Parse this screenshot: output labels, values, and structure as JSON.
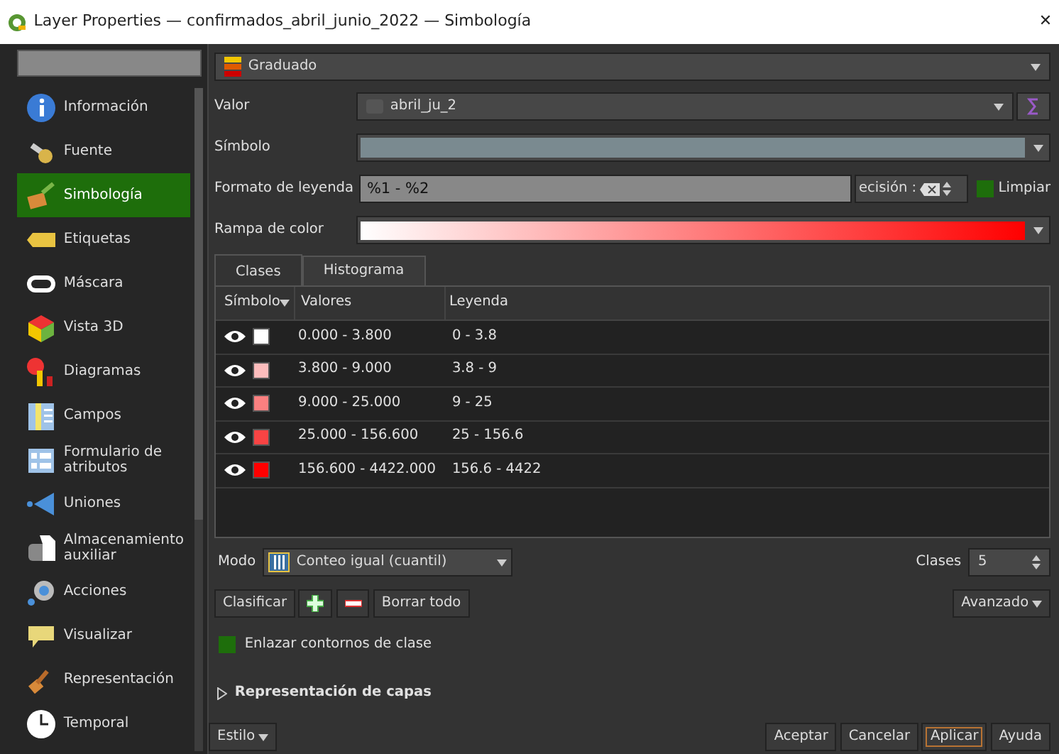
{
  "window": {
    "title": "Layer Properties — confirmados_abril_junio_2022 — Simbología",
    "close": "✕"
  },
  "sidebar": {
    "items": [
      {
        "label": "Información",
        "selected": false
      },
      {
        "label": "Fuente",
        "selected": false
      },
      {
        "label": "Simbología",
        "selected": true
      },
      {
        "label": "Etiquetas",
        "selected": false
      },
      {
        "label": "Máscara",
        "selected": false
      },
      {
        "label": "Vista 3D",
        "selected": false
      },
      {
        "label": "Diagramas",
        "selected": false
      },
      {
        "label": "Campos",
        "selected": false
      },
      {
        "label": "Formulario de atributos",
        "selected": false
      },
      {
        "label": "Uniones",
        "selected": false
      },
      {
        "label": "Almacenamiento auxiliar",
        "selected": false
      },
      {
        "label": "Acciones",
        "selected": false
      },
      {
        "label": "Visualizar",
        "selected": false
      },
      {
        "label": "Representación",
        "selected": false
      },
      {
        "label": "Temporal",
        "selected": false
      }
    ]
  },
  "renderer": "Graduado",
  "form": {
    "valor_label": "Valor",
    "valor": "abril_ju_2",
    "simbolo_label": "Símbolo",
    "formato_label": "Formato de leyenda",
    "formato": "%1 - %2",
    "precision": "ecisión :",
    "limpiar": {
      "label": "Limpiar",
      "checked": true
    },
    "rampa_label": "Rampa de color"
  },
  "tabs": [
    {
      "label": "Clases",
      "selected": true
    },
    {
      "label": "Histograma",
      "selected": false
    }
  ],
  "table": {
    "columns": [
      "Símbolo",
      "Valores",
      "Leyenda"
    ],
    "rows": [
      {
        "visible": true,
        "color": "#ffffff",
        "values": "0.000 - 3.800",
        "legend": "0 - 3.8"
      },
      {
        "visible": true,
        "color": "#fcbcbc",
        "values": "3.800 - 9.000",
        "legend": "3.8 - 9"
      },
      {
        "visible": true,
        "color": "#fb8080",
        "values": "9.000 - 25.000",
        "legend": "9 - 25"
      },
      {
        "visible": true,
        "color": "#f94444",
        "values": "25.000 - 156.600",
        "legend": "25 - 156.6"
      },
      {
        "visible": true,
        "color": "#ff0000",
        "values": "156.600 - 4422.000",
        "legend": "156.6 - 4422"
      }
    ]
  },
  "modo": {
    "label": "Modo",
    "value": "Conteo igual (cuantil)"
  },
  "clases": {
    "label": "Clases",
    "value": "5"
  },
  "actions": {
    "clasificar": "Clasificar",
    "borrar": "Borrar todo",
    "avanzado": "Avanzado"
  },
  "enlazar": {
    "label": "Enlazar contornos de clase",
    "checked": true
  },
  "layer_rendering": {
    "label": "Representación de capas",
    "expanded": false
  },
  "footer": {
    "estilo": "Estilo",
    "buttons": [
      {
        "label": "Aceptar",
        "focused": false
      },
      {
        "label": "Cancelar",
        "focused": false
      },
      {
        "label": "Aplicar",
        "focused": true
      },
      {
        "label": "Ayuda",
        "focused": false
      }
    ]
  }
}
